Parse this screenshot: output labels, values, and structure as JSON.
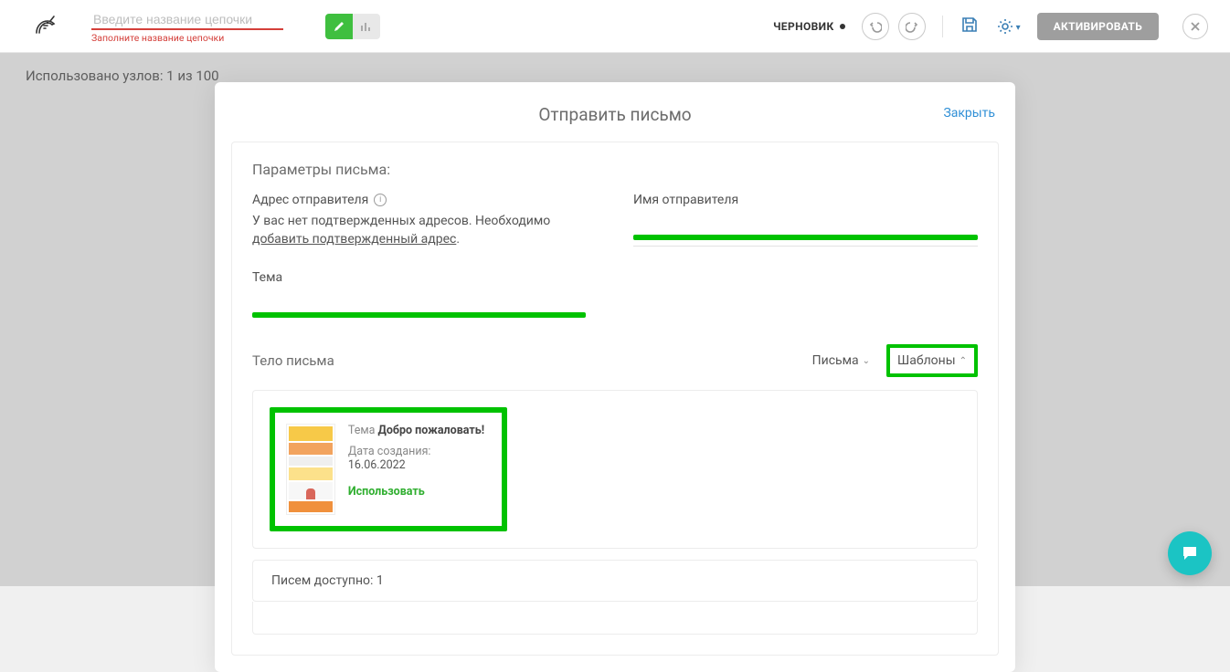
{
  "header": {
    "name_placeholder": "Введите название цепочки",
    "name_hint": "Заполните название цепочки",
    "status_label": "ЧЕРНОВИК",
    "activate_label": "АКТИВИРОВАТЬ"
  },
  "page": {
    "nodes_used": "Использовано узлов: 1 из 100"
  },
  "modal": {
    "title": "Отправить письмо",
    "close": "Закрыть",
    "section_title": "Параметры письма:",
    "sender_address_label": "Адрес отправителя",
    "sender_address_msg_1": "У вас нет подтвержденных адресов. Необходимо ",
    "sender_address_link": "добавить подтвержденный адрес",
    "sender_name_label": "Имя отправителя",
    "subject_label": "Тема",
    "body_label": "Тело письма",
    "tab_emails": "Письма",
    "tab_templates": "Шаблоны",
    "template": {
      "subject_label": "Тема",
      "subject_value": "Добро пожаловать!",
      "date_label": "Дата создания:",
      "date_value": "16.06.2022",
      "use_label": "Использовать"
    },
    "footer_available": "Писем доступно: 1"
  }
}
